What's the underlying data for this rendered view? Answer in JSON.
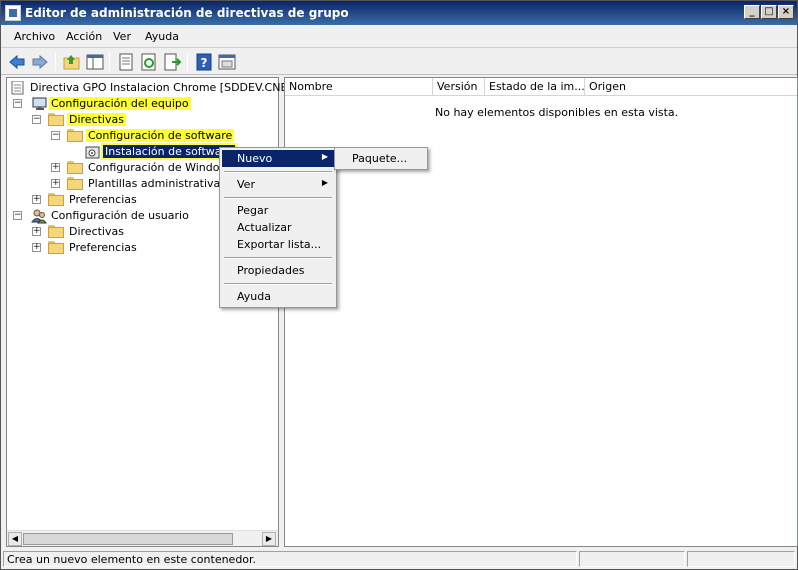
{
  "window": {
    "title": "Editor de administración de directivas de grupo",
    "controls": {
      "minimize": "_",
      "maximize": "□",
      "close": "×"
    }
  },
  "menubar": {
    "items": [
      "Archivo",
      "Acción",
      "Ver",
      "Ayuda"
    ]
  },
  "toolbar": {
    "icons": [
      "back-arrow-icon",
      "forward-arrow-icon",
      "up-folder-icon",
      "show-hide-tree-icon",
      "properties-icon",
      "refresh-icon",
      "export-icon",
      "help-icon",
      "console-view-icon"
    ]
  },
  "tree": {
    "root": "Directiva GPO Instalacion Chrome [SDDEV.CNBT.LO",
    "computer_config": "Configuración del equipo",
    "directivas": "Directivas",
    "software_config": "Configuración de software",
    "software_install": "Instalación de software",
    "windows_config": "Configuración de Windows",
    "admin_templates": "Plantillas administrativas: de",
    "preferences": "Preferencias",
    "user_config": "Configuración de usuario",
    "user_directivas": "Directivas",
    "user_preferences": "Preferencias",
    "expanded_symbol": "−",
    "collapsed_symbol": "+"
  },
  "list": {
    "columns": [
      "Nombre",
      "Versión",
      "Estado de la im...",
      "Origen"
    ],
    "empty_message": "No hay elementos disponibles en esta vista."
  },
  "context_menu": {
    "items": [
      "Nuevo",
      "Ver",
      "Pegar",
      "Actualizar",
      "Exportar lista...",
      "Propiedades",
      "Ayuda"
    ],
    "submenu_arrow": "▶",
    "submenu": {
      "items": [
        "Paquete..."
      ]
    }
  },
  "statusbar": {
    "text": "Crea un nuevo elemento en este contenedor."
  },
  "scrollbar": {
    "left_arrow": "◀",
    "right_arrow": "▶"
  },
  "colors": {
    "highlight": "#ffff33",
    "selection": "#0a246a",
    "title_start": "#0a246a"
  }
}
